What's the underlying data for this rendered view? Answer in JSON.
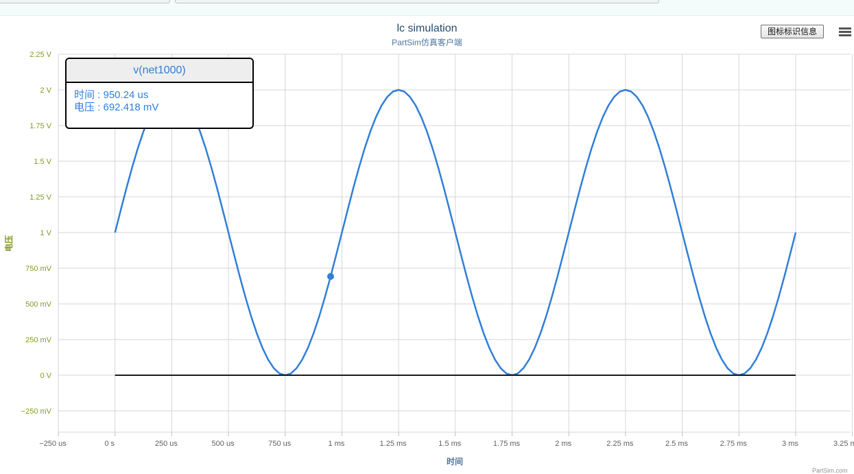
{
  "chart_data": {
    "type": "line",
    "title": "lc simulation",
    "subtitle": "PartSim仿真客户端",
    "xlabel": "时间",
    "ylabel": "电压",
    "x_unit": "us",
    "y_unit": "mV",
    "xlim": [
      -250,
      3250
    ],
    "ylim": [
      -400,
      2250
    ],
    "x_ticks": [
      {
        "value": -250,
        "label": "−250 us"
      },
      {
        "value": 0,
        "label": "0 s"
      },
      {
        "value": 250,
        "label": "250 us"
      },
      {
        "value": 500,
        "label": "500 us"
      },
      {
        "value": 750,
        "label": "750 us"
      },
      {
        "value": 1000,
        "label": "1 ms"
      },
      {
        "value": 1250,
        "label": "1.25 ms"
      },
      {
        "value": 1500,
        "label": "1.5 ms"
      },
      {
        "value": 1750,
        "label": "1.75 ms"
      },
      {
        "value": 2000,
        "label": "2 ms"
      },
      {
        "value": 2250,
        "label": "2.25 ms"
      },
      {
        "value": 2500,
        "label": "2.5 ms"
      },
      {
        "value": 2750,
        "label": "2.75 ms"
      },
      {
        "value": 3000,
        "label": "3 ms"
      },
      {
        "value": 3250,
        "label": "3.25 ms"
      }
    ],
    "y_ticks": [
      {
        "value": -250,
        "label": "−250 mV"
      },
      {
        "value": 0,
        "label": "0 V"
      },
      {
        "value": 250,
        "label": "250 mV"
      },
      {
        "value": 500,
        "label": "500 mV"
      },
      {
        "value": 750,
        "label": "750 mV"
      },
      {
        "value": 1000,
        "label": "1 V"
      },
      {
        "value": 1250,
        "label": "1.25 V"
      },
      {
        "value": 1500,
        "label": "1.5 V"
      },
      {
        "value": 1750,
        "label": "1.75 V"
      },
      {
        "value": 2000,
        "label": "2 V"
      },
      {
        "value": 2250,
        "label": "2.25 V"
      }
    ],
    "grid": true,
    "series": [
      {
        "name": "v(net1000)",
        "color": "#2f7ed8",
        "x": [
          0,
          25,
          50,
          75,
          100,
          125,
          150,
          175,
          200,
          225,
          250,
          275,
          300,
          325,
          350,
          375,
          400,
          425,
          450,
          475,
          500,
          525,
          550,
          575,
          600,
          625,
          650,
          675,
          700,
          725,
          750,
          775,
          800,
          825,
          850,
          875,
          900,
          925,
          950,
          975,
          1000,
          1025,
          1050,
          1075,
          1100,
          1125,
          1150,
          1175,
          1200,
          1225,
          1250,
          1275,
          1300,
          1325,
          1350,
          1375,
          1400,
          1425,
          1450,
          1475,
          1500,
          1525,
          1550,
          1575,
          1600,
          1625,
          1650,
          1675,
          1700,
          1725,
          1750,
          1775,
          1800,
          1825,
          1850,
          1875,
          1900,
          1925,
          1950,
          1975,
          2000,
          2025,
          2050,
          2075,
          2100,
          2125,
          2150,
          2175,
          2200,
          2225,
          2250,
          2275,
          2300,
          2325,
          2350,
          2375,
          2400,
          2425,
          2450,
          2475,
          2500,
          2525,
          2550,
          2575,
          2600,
          2625,
          2650,
          2675,
          2700,
          2725,
          2750,
          2775,
          2800,
          2825,
          2850,
          2875,
          2900,
          2925,
          2950,
          2975,
          3000
        ],
        "values": [
          1000,
          1156,
          1309,
          1454,
          1588,
          1707,
          1809,
          1891,
          1951,
          1988,
          2000,
          1988,
          1951,
          1891,
          1809,
          1707,
          1588,
          1454,
          1309,
          1156,
          1000,
          844,
          691,
          546,
          412,
          293,
          191,
          109,
          49,
          12,
          0,
          12,
          49,
          109,
          191,
          293,
          412,
          546,
          691,
          844,
          1000,
          1156,
          1309,
          1454,
          1588,
          1707,
          1809,
          1891,
          1951,
          1988,
          2000,
          1988,
          1951,
          1891,
          1809,
          1707,
          1588,
          1454,
          1309,
          1156,
          1000,
          844,
          691,
          546,
          412,
          293,
          191,
          109,
          49,
          12,
          0,
          12,
          49,
          109,
          191,
          293,
          412,
          546,
          691,
          844,
          1000,
          1156,
          1309,
          1454,
          1588,
          1707,
          1809,
          1891,
          1951,
          1988,
          2000,
          1988,
          1951,
          1891,
          1809,
          1707,
          1588,
          1454,
          1309,
          1156,
          1000,
          844,
          691,
          546,
          412,
          293,
          191,
          109,
          49,
          12,
          0,
          12,
          49,
          109,
          191,
          293,
          412,
          546,
          691,
          844,
          1000
        ]
      },
      {
        "color": "#1a1a1a",
        "x": [
          0,
          3000
        ],
        "values": [
          0,
          0
        ]
      }
    ],
    "highlight_point": {
      "x": 950.24,
      "y": 692.418
    }
  },
  "tooltip": {
    "series_name": "v(net1000)",
    "time_line": "时间 : 950.24 us",
    "voltage_line": "电压 : 692.418 mV"
  },
  "controls": {
    "legend_button_label": "图标标识信息",
    "menu_icon": "hamburger-menu-icon"
  },
  "credit": "PartSim.com"
}
